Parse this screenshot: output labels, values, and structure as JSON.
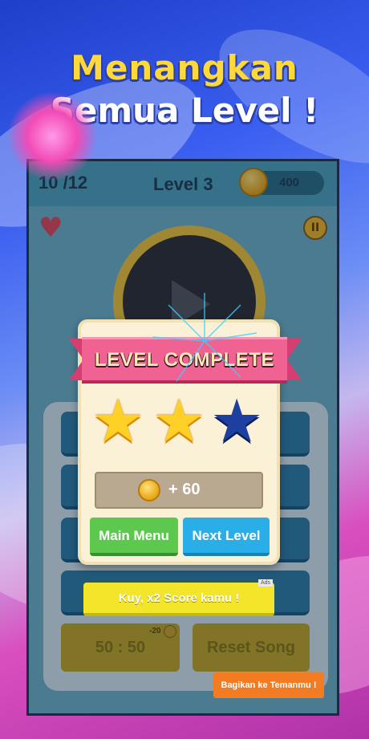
{
  "promo": {
    "line1": "Menangkan",
    "line2": "Semua Level !"
  },
  "game": {
    "progress": "10 /12",
    "level_title": "Level 3",
    "coins": "400",
    "pause_icon": "pause-icon",
    "heart_icon": "heart-icon",
    "heart_glyph": "♥",
    "pause_glyph": "II"
  },
  "answers": {
    "fifty_label": "50 : 50",
    "fifty_cost": "-20",
    "reset_label": "Reset Song"
  },
  "modal": {
    "title": "LEVEL COMPLETE",
    "stars_earned": 2,
    "stars_total": 3,
    "star_glyph": "★",
    "reward": "+ 60",
    "main_menu_label": "Main Menu",
    "next_level_label": "Next Level"
  },
  "actions": {
    "x2_label": "Kuy, x2 Score kamu !",
    "ads_label": "Ads",
    "share_label": "Bagikan ke Temanmu !"
  },
  "colors": {
    "ribbon": "#f06292",
    "star_gold": "#ffd025",
    "star_empty": "#1d3fa0",
    "main_menu": "#5cc94e",
    "next_level": "#2aaee8",
    "x2": "#f2e52a",
    "share": "#f37b22"
  }
}
